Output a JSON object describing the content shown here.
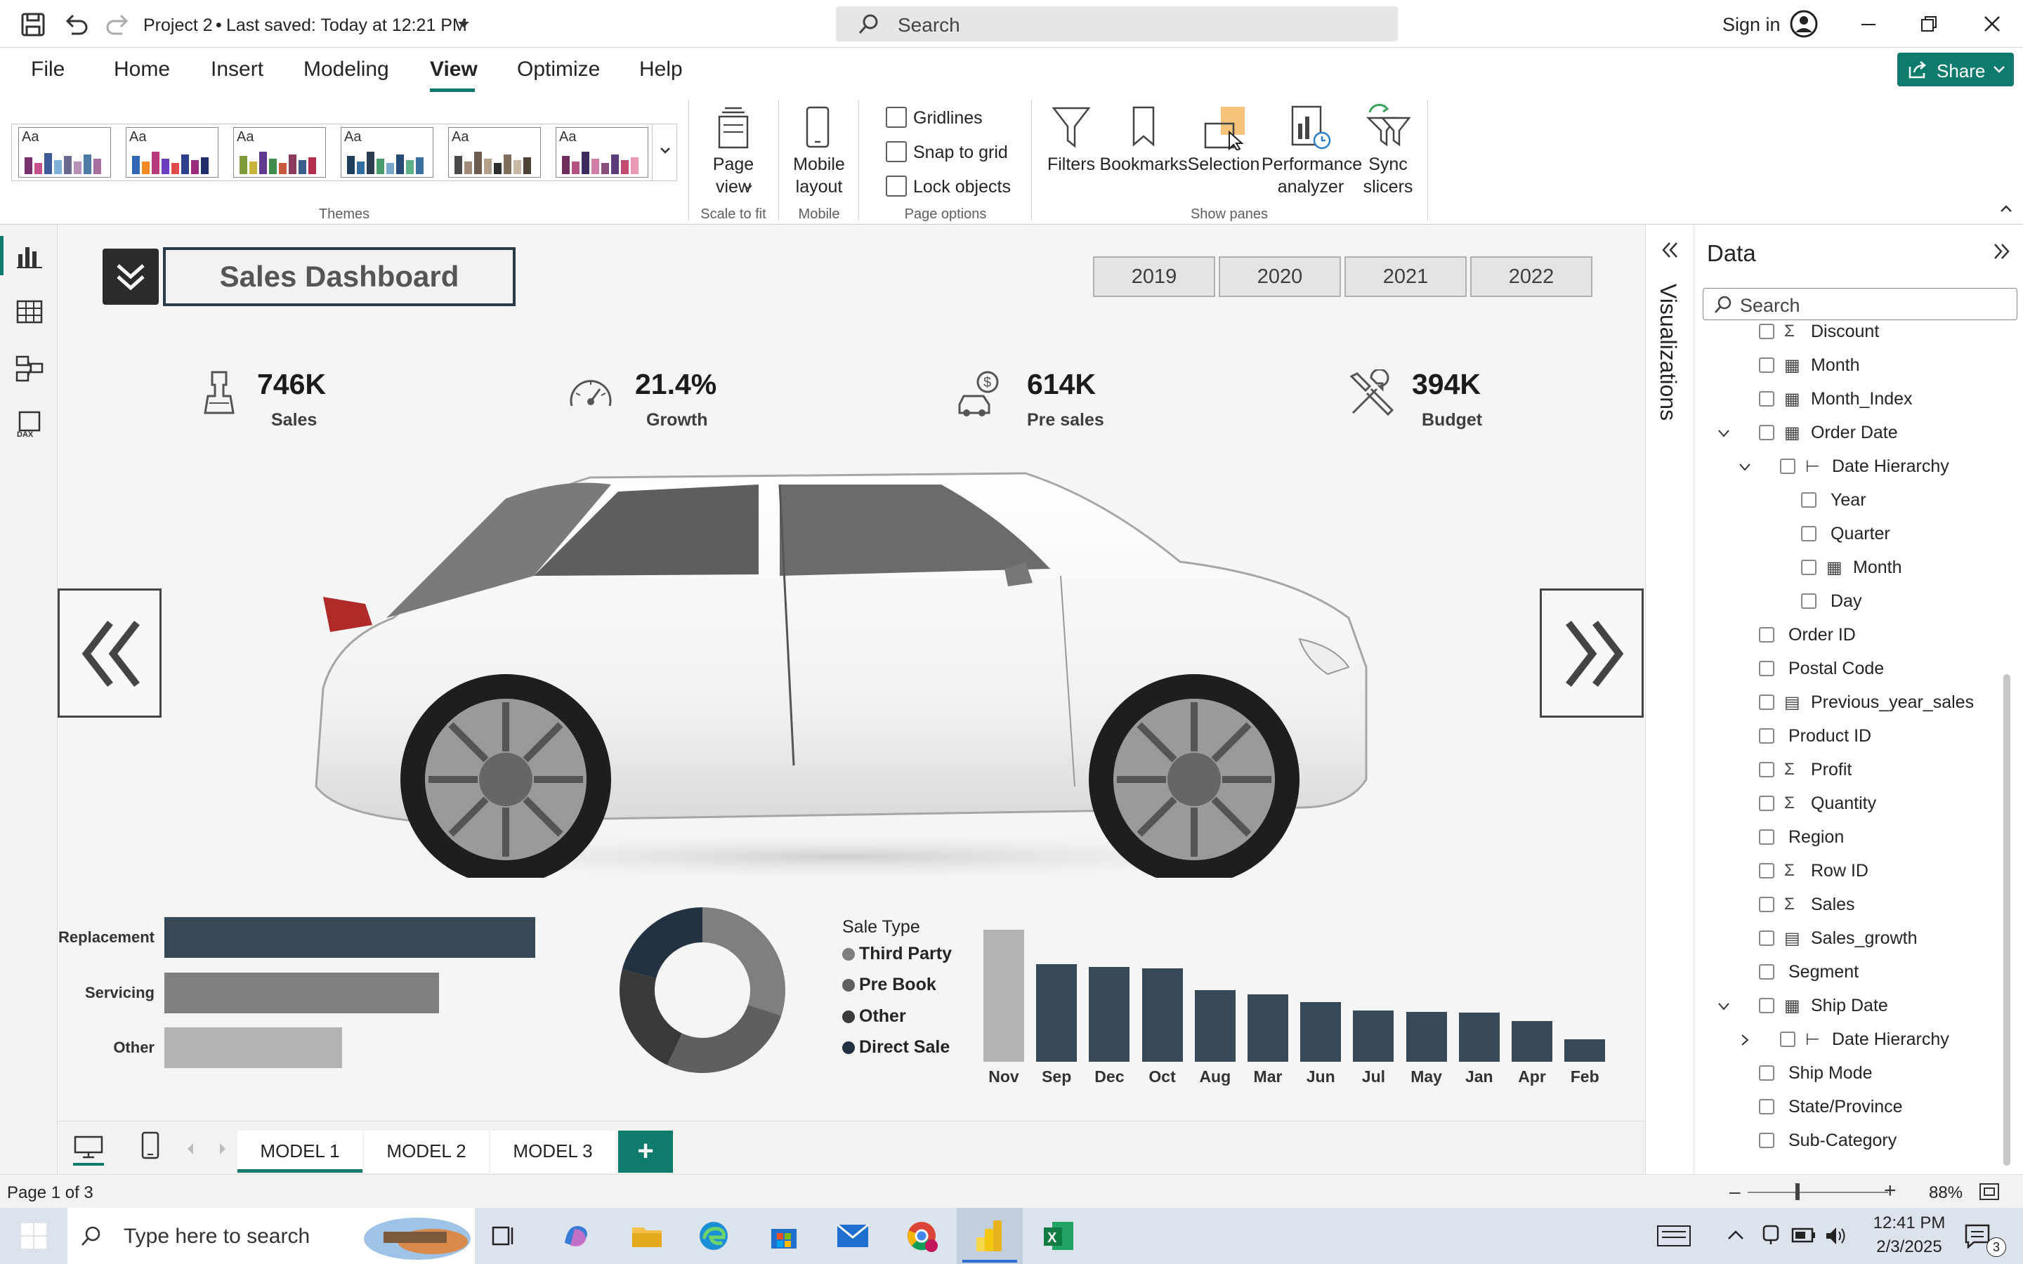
{
  "titlebar": {
    "project": "Project 2",
    "separator": "•",
    "saved": "Last saved: Today at 12:21 PM",
    "search_placeholder": "Search",
    "sign_in": "Sign in"
  },
  "menu": {
    "tabs": [
      "File",
      "Home",
      "Insert",
      "Modeling",
      "View",
      "Optimize",
      "Help"
    ],
    "active": "View",
    "share": "Share"
  },
  "ribbon": {
    "themes_label": "Themes",
    "theme_preview_text": "Aa",
    "page_view": "Page view",
    "scale_group": "Scale to fit",
    "mobile_layout": "Mobile layout",
    "mobile_group": "Mobile",
    "page_options": [
      "Gridlines",
      "Snap to grid",
      "Lock objects"
    ],
    "page_options_group": "Page options",
    "show_panes": [
      "Filters",
      "Bookmarks",
      "Selection",
      "Performance analyzer",
      "Sync slicers"
    ],
    "show_panes_group": "Show panes"
  },
  "dashboard": {
    "title": "Sales Dashboard",
    "years": [
      "2019",
      "2020",
      "2021",
      "2022"
    ],
    "kpis": [
      {
        "value": "746K",
        "label": "Sales",
        "icon": "car-seat-icon"
      },
      {
        "value": "21.4%",
        "label": "Growth",
        "icon": "speedometer-icon"
      },
      {
        "value": "614K",
        "label": "Pre sales",
        "icon": "car-dollar-icon"
      },
      {
        "value": "394K",
        "label": "Budget",
        "icon": "tools-icon"
      }
    ]
  },
  "chart_data": [
    {
      "type": "bar",
      "orientation": "horizontal",
      "categories": [
        "Replacement",
        "Servicing",
        "Other"
      ],
      "values": [
        100,
        74,
        48
      ],
      "colors": [
        "#374957",
        "#7f7f7f",
        "#b3b3b3"
      ]
    },
    {
      "type": "pie",
      "variant": "donut",
      "legend_title": "Sale Type",
      "categories": [
        "Third Party",
        "Pre Book",
        "Other",
        "Direct Sale"
      ],
      "values": [
        30,
        27,
        22,
        21
      ],
      "colors": [
        "#7f7f7f",
        "#5f5f5f",
        "#3a3a3a",
        "#233240"
      ],
      "legend_placement": "right"
    },
    {
      "type": "bar",
      "categories": [
        "Nov",
        "Sep",
        "Dec",
        "Oct",
        "Aug",
        "Mar",
        "Jun",
        "Jul",
        "May",
        "Jan",
        "Apr",
        "Feb"
      ],
      "values": [
        100,
        74,
        72,
        71,
        54,
        51,
        45,
        39,
        38,
        37,
        31,
        17
      ],
      "highlight_color": "#b3b3b3",
      "color": "#374957"
    }
  ],
  "pages": {
    "tabs": [
      "MODEL 1",
      "MODEL 2",
      "MODEL 3"
    ],
    "active": "MODEL 1",
    "add": "+"
  },
  "panes": {
    "visualizations": "Visualizations",
    "data_title": "Data",
    "search_placeholder": "Search"
  },
  "fields": [
    {
      "label": "Discount",
      "icon": "sigma",
      "level": 0
    },
    {
      "label": "Month",
      "icon": "calc",
      "level": 0
    },
    {
      "label": "Month_Index",
      "icon": "calc",
      "level": 0
    },
    {
      "label": "Order Date",
      "icon": "calendar",
      "level": 0,
      "expanded": true
    },
    {
      "label": "Date Hierarchy",
      "icon": "hierarchy",
      "level": 1,
      "expanded": true
    },
    {
      "label": "Year",
      "icon": "",
      "level": 2
    },
    {
      "label": "Quarter",
      "icon": "",
      "level": 2
    },
    {
      "label": "Month",
      "icon": "calc",
      "level": 2
    },
    {
      "label": "Day",
      "icon": "",
      "level": 2
    },
    {
      "label": "Order ID",
      "icon": "",
      "level": 0
    },
    {
      "label": "Postal Code",
      "icon": "",
      "level": 0
    },
    {
      "label": "Previous_year_sales",
      "icon": "calculator",
      "level": 0
    },
    {
      "label": "Product ID",
      "icon": "",
      "level": 0
    },
    {
      "label": "Profit",
      "icon": "sigma",
      "level": 0
    },
    {
      "label": "Quantity",
      "icon": "sigma",
      "level": 0
    },
    {
      "label": "Region",
      "icon": "",
      "level": 0
    },
    {
      "label": "Row ID",
      "icon": "sigma",
      "level": 0
    },
    {
      "label": "Sales",
      "icon": "sigma",
      "level": 0
    },
    {
      "label": "Sales_growth",
      "icon": "calculator",
      "level": 0
    },
    {
      "label": "Segment",
      "icon": "",
      "level": 0
    },
    {
      "label": "Ship Date",
      "icon": "calendar",
      "level": 0,
      "expanded": true
    },
    {
      "label": "Date Hierarchy",
      "icon": "hierarchy",
      "level": 1,
      "expanded": false
    },
    {
      "label": "Ship Mode",
      "icon": "",
      "level": 0
    },
    {
      "label": "State/Province",
      "icon": "",
      "level": 0
    },
    {
      "label": "Sub-Category",
      "icon": "",
      "level": 0
    }
  ],
  "status": {
    "page": "Page 1 of 3",
    "zoom": "88%"
  },
  "taskbar": {
    "search_placeholder": "Type here to search",
    "time": "12:41 PM",
    "date": "2/3/2025",
    "notifications": "3"
  }
}
